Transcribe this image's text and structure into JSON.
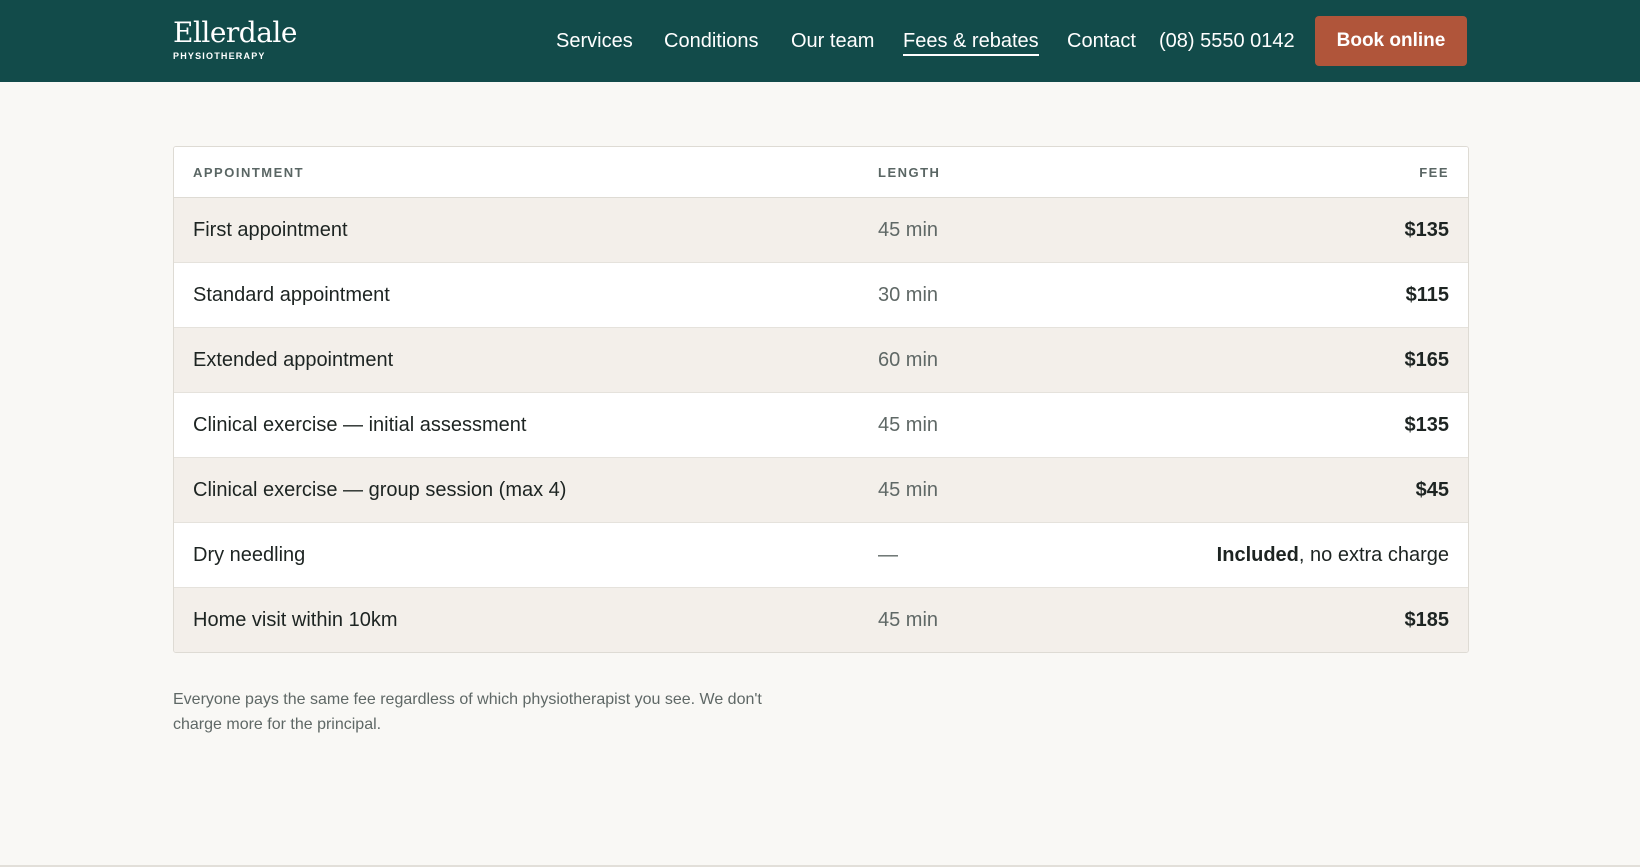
{
  "header": {
    "brand_name": "Ellerdale",
    "brand_sub": "PHYSIOTHERAPY",
    "nav": [
      {
        "label": "Services"
      },
      {
        "label": "Conditions"
      },
      {
        "label": "Our team"
      },
      {
        "label": "Fees & rebates",
        "active": true
      },
      {
        "label": "Contact"
      }
    ],
    "phone": "(08) 5550 0142",
    "cta_label": "Book online"
  },
  "fees_table": {
    "columns": [
      "APPOINTMENT",
      "LENGTH",
      "FEE"
    ],
    "rows": [
      {
        "appointment": "First appointment",
        "length": "45 min",
        "fee": "$135"
      },
      {
        "appointment": "Standard appointment",
        "length": "30 min",
        "fee": "$115"
      },
      {
        "appointment": "Extended appointment",
        "length": "60 min",
        "fee": "$165"
      },
      {
        "appointment": "Clinical exercise — initial assessment",
        "length": "45 min",
        "fee": "$135"
      },
      {
        "appointment": "Clinical exercise — group session (max 4)",
        "length": "45 min",
        "fee": "$45"
      },
      {
        "appointment": "Dry needling",
        "length": "—",
        "fee_strong": "Included",
        "fee_rest": ", no extra charge"
      },
      {
        "appointment": "Home visit within 10km",
        "length": "45 min",
        "fee": "$185"
      }
    ]
  },
  "note": "Everyone pays the same fee regardless of which physiotherapist you see. We don't charge more for the principal.",
  "colors": {
    "header_bg": "#124b4a",
    "cta_bg": "#b0553a",
    "row_shade": "#f3efea",
    "page_bg": "#f9f8f5"
  }
}
